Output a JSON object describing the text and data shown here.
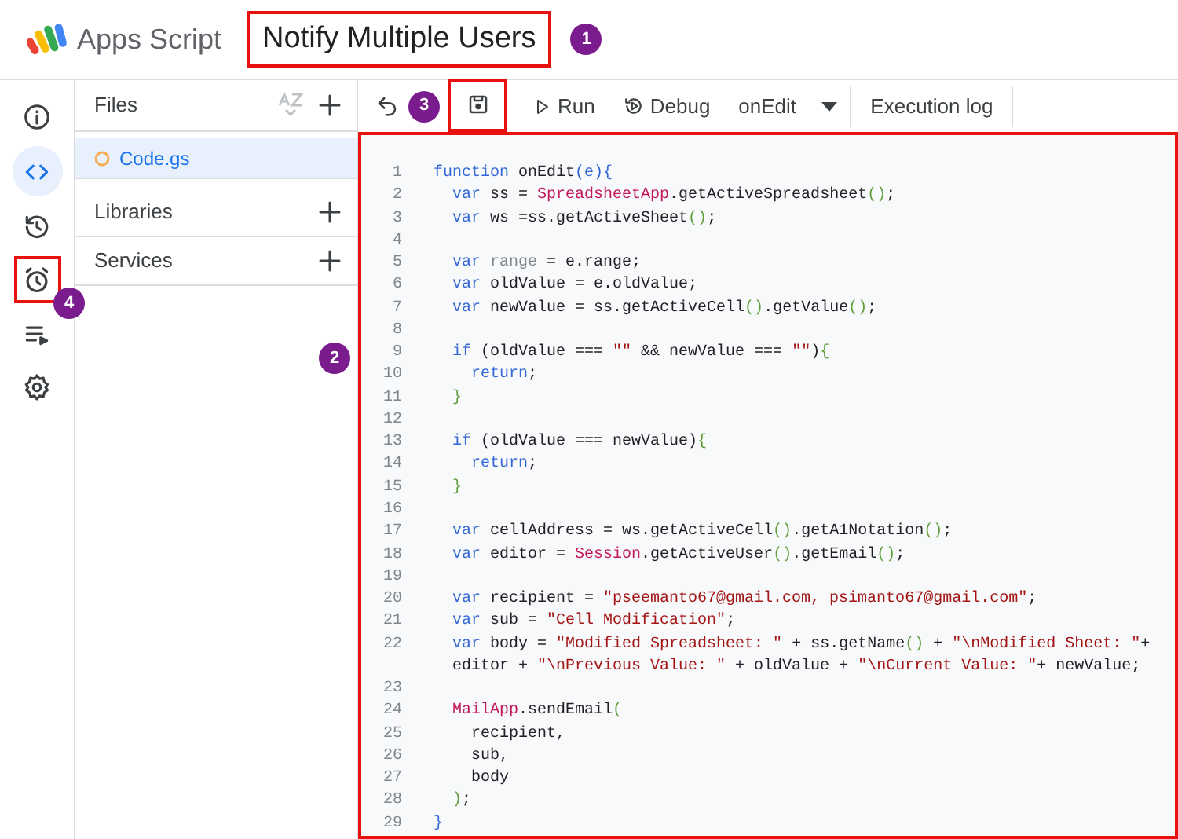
{
  "app": {
    "name": "Apps Script"
  },
  "project": {
    "title": "Notify Multiple Users",
    "highlighted": true
  },
  "nav": [
    {
      "kind": "info",
      "selected": false,
      "highlighted": false
    },
    {
      "kind": "code",
      "selected": true,
      "highlighted": false
    },
    {
      "kind": "history",
      "selected": false,
      "highlighted": false
    },
    {
      "kind": "triggers",
      "selected": false,
      "highlighted": true
    },
    {
      "kind": "executions",
      "selected": false,
      "highlighted": false
    },
    {
      "kind": "settings",
      "selected": false,
      "highlighted": false
    }
  ],
  "files_panel": {
    "title": "Files",
    "files": [
      {
        "name": "Code.gs",
        "selected": true
      }
    ],
    "sections": [
      {
        "label": "Libraries"
      },
      {
        "label": "Services"
      }
    ]
  },
  "toolbar": [
    {
      "kind": "undo",
      "highlighted": false
    },
    {
      "kind": "save",
      "highlighted": true
    },
    {
      "kind": "run",
      "label": "Run",
      "highlighted": false
    },
    {
      "kind": "debug",
      "label": "Debug",
      "highlighted": false
    },
    {
      "kind": "function-select",
      "label": "onEdit",
      "highlighted": false
    },
    {
      "kind": "log",
      "label": "Execution log",
      "highlighted": false
    }
  ],
  "editor": {
    "highlighted": true,
    "lines": [
      {
        "number": "1",
        "tokens": [
          {
            "kind": "kw",
            "text": "function"
          },
          {
            "kind": "txt",
            "text": " onEdit"
          },
          {
            "kind": "kw",
            "text": "(e){"
          }
        ]
      },
      {
        "number": "2",
        "tokens": [
          {
            "kind": "kw",
            "text": "  var"
          },
          {
            "kind": "txt",
            "text": " ss = "
          },
          {
            "kind": "cls",
            "text": "SpreadsheetApp"
          },
          {
            "kind": "txt",
            "text": ".getActiveSpreadsheet"
          },
          {
            "kind": "brk",
            "text": "()"
          },
          {
            "kind": "txt",
            "text": ";"
          }
        ]
      },
      {
        "number": "3",
        "tokens": [
          {
            "kind": "kw",
            "text": "  var"
          },
          {
            "kind": "txt",
            "text": " ws =ss.getActiveSheet"
          },
          {
            "kind": "brk",
            "text": "()"
          },
          {
            "kind": "txt",
            "text": ";"
          }
        ]
      },
      {
        "number": "4"
      },
      {
        "number": "5",
        "tokens": [
          {
            "kind": "kw",
            "text": "  var"
          },
          {
            "kind": "dim",
            "text": " range"
          },
          {
            "kind": "txt",
            "text": " = e.range;"
          }
        ]
      },
      {
        "number": "6",
        "tokens": [
          {
            "kind": "kw",
            "text": "  var"
          },
          {
            "kind": "txt",
            "text": " oldValue = e.oldValue;"
          }
        ]
      },
      {
        "number": "7",
        "tokens": [
          {
            "kind": "kw",
            "text": "  var"
          },
          {
            "kind": "txt",
            "text": " newValue = ss.getActiveCell"
          },
          {
            "kind": "brk",
            "text": "()"
          },
          {
            "kind": "txt",
            "text": ".getValue"
          },
          {
            "kind": "brk",
            "text": "()"
          },
          {
            "kind": "txt",
            "text": ";"
          }
        ]
      },
      {
        "number": "8"
      },
      {
        "number": "9",
        "tokens": [
          {
            "kind": "kw",
            "text": "  if"
          },
          {
            "kind": "txt",
            "text": " (oldValue === "
          },
          {
            "kind": "str",
            "text": "\"\""
          },
          {
            "kind": "txt",
            "text": " && newValue === "
          },
          {
            "kind": "str",
            "text": "\"\""
          },
          {
            "kind": "txt",
            "text": ")"
          },
          {
            "kind": "brk",
            "text": "{"
          }
        ]
      },
      {
        "number": "10",
        "tokens": [
          {
            "kind": "kw",
            "text": "    return"
          },
          {
            "kind": "txt",
            "text": ";"
          }
        ]
      },
      {
        "number": "11",
        "tokens": [
          {
            "kind": "brk",
            "text": "  }"
          }
        ]
      },
      {
        "number": "12"
      },
      {
        "number": "13",
        "tokens": [
          {
            "kind": "kw",
            "text": "  if"
          },
          {
            "kind": "txt",
            "text": " (oldValue === newValue)"
          },
          {
            "kind": "brk",
            "text": "{"
          }
        ]
      },
      {
        "number": "14",
        "tokens": [
          {
            "kind": "kw",
            "text": "    return"
          },
          {
            "kind": "txt",
            "text": ";"
          }
        ]
      },
      {
        "number": "15",
        "tokens": [
          {
            "kind": "brk",
            "text": "  }"
          }
        ]
      },
      {
        "number": "16"
      },
      {
        "number": "17",
        "tokens": [
          {
            "kind": "kw",
            "text": "  var"
          },
          {
            "kind": "txt",
            "text": " cellAddress = ws.getActiveCell"
          },
          {
            "kind": "brk",
            "text": "()"
          },
          {
            "kind": "txt",
            "text": ".getA1Notation"
          },
          {
            "kind": "brk",
            "text": "()"
          },
          {
            "kind": "txt",
            "text": ";"
          }
        ]
      },
      {
        "number": "18",
        "tokens": [
          {
            "kind": "kw",
            "text": "  var"
          },
          {
            "kind": "txt",
            "text": " editor = "
          },
          {
            "kind": "cls",
            "text": "Session"
          },
          {
            "kind": "txt",
            "text": ".getActiveUser"
          },
          {
            "kind": "brk",
            "text": "()"
          },
          {
            "kind": "txt",
            "text": ".getEmail"
          },
          {
            "kind": "brk",
            "text": "()"
          },
          {
            "kind": "txt",
            "text": ";"
          }
        ]
      },
      {
        "number": "19"
      },
      {
        "number": "20",
        "tokens": [
          {
            "kind": "kw",
            "text": "  var"
          },
          {
            "kind": "txt",
            "text": " recipient = "
          },
          {
            "kind": "str",
            "text": "\"pseemanto67@gmail.com, psimanto67@gmail.com\""
          },
          {
            "kind": "txt",
            "text": ";"
          }
        ]
      },
      {
        "number": "21",
        "tokens": [
          {
            "kind": "kw",
            "text": "  var"
          },
          {
            "kind": "txt",
            "text": " sub = "
          },
          {
            "kind": "str",
            "text": "\"Cell Modification\""
          },
          {
            "kind": "txt",
            "text": ";"
          }
        ]
      },
      {
        "number": "22",
        "tokens": [
          {
            "kind": "kw",
            "text": "  var"
          },
          {
            "kind": "txt",
            "text": " body = "
          },
          {
            "kind": "str",
            "text": "\"Modified Spreadsheet: \""
          },
          {
            "kind": "txt",
            "text": " + ss.getName"
          },
          {
            "kind": "brk",
            "text": "()"
          },
          {
            "kind": "txt",
            "text": " + "
          },
          {
            "kind": "str",
            "text": "\"\\nModified Sheet: \""
          },
          {
            "kind": "txt",
            "text": "+"
          }
        ]
      },
      {
        "tokens": [
          {
            "kind": "txt",
            "text": "  editor + "
          },
          {
            "kind": "str",
            "text": "\"\\nPrevious Value: \""
          },
          {
            "kind": "txt",
            "text": " + oldValue + "
          },
          {
            "kind": "str",
            "text": "\"\\nCurrent Value: \""
          },
          {
            "kind": "txt",
            "text": "+ newValue;"
          }
        ]
      },
      {
        "number": "23"
      },
      {
        "number": "24",
        "tokens": [
          {
            "kind": "cls",
            "text": "  MailApp"
          },
          {
            "kind": "txt",
            "text": ".sendEmail"
          },
          {
            "kind": "brk",
            "text": "("
          }
        ]
      },
      {
        "number": "25",
        "tokens": [
          {
            "kind": "txt",
            "text": "    recipient,"
          }
        ]
      },
      {
        "number": "26",
        "tokens": [
          {
            "kind": "txt",
            "text": "    sub,"
          }
        ]
      },
      {
        "number": "27",
        "tokens": [
          {
            "kind": "txt",
            "text": "    body"
          }
        ]
      },
      {
        "number": "28",
        "tokens": [
          {
            "kind": "brk",
            "text": "  )"
          },
          {
            "kind": "txt",
            "text": ";"
          }
        ]
      },
      {
        "number": "29",
        "tokens": [
          {
            "kind": "kw",
            "text": "}"
          }
        ]
      }
    ]
  },
  "callouts": [
    {
      "label": "1",
      "kind": "title"
    },
    {
      "label": "2",
      "kind": "files"
    },
    {
      "label": "3",
      "kind": "toolbar"
    },
    {
      "label": "4",
      "kind": "nav"
    }
  ]
}
